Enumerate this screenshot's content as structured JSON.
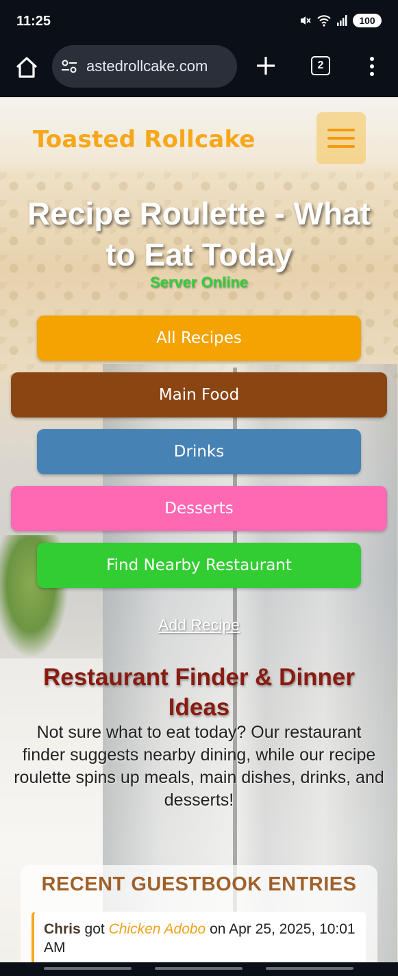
{
  "status_bar": {
    "time": "11:25",
    "battery": "100",
    "icons": [
      "mute-icon",
      "wifi-icon",
      "signal-icon",
      "battery-icon"
    ]
  },
  "browser": {
    "url": "astedrollcake.com",
    "tab_count": "2",
    "icons": [
      "home-icon",
      "site-settings-icon",
      "new-tab-icon",
      "tabs-icon",
      "more-icon"
    ]
  },
  "site": {
    "brand": "Toasted Rollcake",
    "hero_title_line1": "Recipe Roulette - What",
    "hero_title_line2": "to Eat Today",
    "server_status": "Server Online",
    "buttons": {
      "all_recipes": "All Recipes",
      "main_food": "Main Food",
      "drinks": "Drinks",
      "desserts": "Desserts",
      "find_restaurant": "Find Nearby Restaurant"
    },
    "add_recipe": "Add Recipe",
    "section_title_line1": "Restaurant Finder & Dinner",
    "section_title_line2": "Ideas",
    "section_text": "Not sure what to eat today? Our restaurant finder suggests nearby dining, while our recipe roulette spins up meals, main dishes, drinks, and desserts!",
    "guestbook": {
      "title": "RECENT GUESTBOOK ENTRIES",
      "entries": [
        {
          "name": "Chris",
          "verb": "got",
          "dish": "Chicken Adobo",
          "on": "on",
          "date": "Apr 25, 2025,",
          "time": "10:01 AM"
        }
      ]
    }
  },
  "colors": {
    "brand": "#f6a71a",
    "all_recipes": "#f4a300",
    "main_food": "#8b4513",
    "drinks": "#4682b4",
    "desserts": "#ff69b4",
    "find_restaurant": "#32cd32",
    "server_online": "#2fcf3a",
    "section_title": "#8a1b12"
  }
}
